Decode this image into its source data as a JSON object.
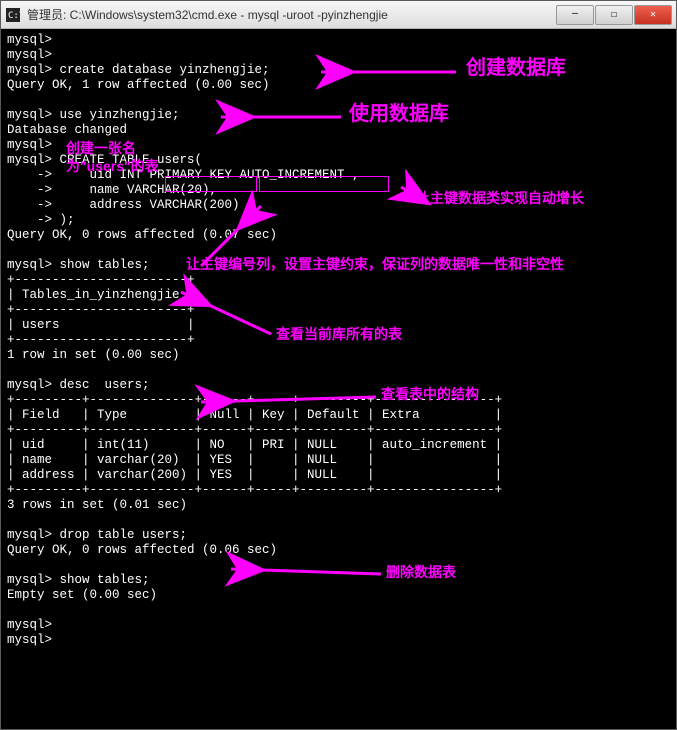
{
  "window": {
    "title": "管理员: C:\\Windows\\system32\\cmd.exe - mysql  -uroot -pyinzhengjie",
    "icon": "cmd-icon"
  },
  "controls": {
    "minimize": "—",
    "maximize": "☐",
    "close": "✕"
  },
  "terminal_lines": [
    "mysql>",
    "mysql>",
    "mysql> create database yinzhengjie;",
    "Query OK, 1 row affected (0.00 sec)",
    "",
    "mysql> use yinzhengjie;",
    "Database changed",
    "mysql>",
    "mysql> CREATE TABLE users(",
    "    ->     uid INT PRIMARY KEY AUTO_INCREMENT ,",
    "    ->     name VARCHAR(20),",
    "    ->     address VARCHAR(200)",
    "    -> );",
    "Query OK, 0 rows affected (0.07 sec)",
    "",
    "mysql> show tables;",
    "+-----------------------+",
    "| Tables_in_yinzhengjie |",
    "+-----------------------+",
    "| users                 |",
    "+-----------------------+",
    "1 row in set (0.00 sec)",
    "",
    "mysql> desc  users;",
    "+---------+--------------+------+-----+---------+----------------+",
    "| Field   | Type         | Null | Key | Default | Extra          |",
    "+---------+--------------+------+-----+---------+----------------+",
    "| uid     | int(11)      | NO   | PRI | NULL    | auto_increment |",
    "| name    | varchar(20)  | YES  |     | NULL    |                |",
    "| address | varchar(200) | YES  |     | NULL    |                |",
    "+---------+--------------+------+-----+---------+----------------+",
    "3 rows in set (0.01 sec)",
    "",
    "mysql> drop table users;",
    "Query OK, 0 rows affected (0.06 sec)",
    "",
    "mysql> show tables;",
    "Empty set (0.00 sec)",
    "",
    "mysql>",
    "mysql>"
  ],
  "annotations": {
    "create_db": "创建数据库",
    "use_db": "使用数据库",
    "create_table": "创建一张名\n为\"users\"的表",
    "auto_inc": "让主键数据类实现自动增长",
    "pk_note": "让主键编号列，设置主键约束，保证列的数据唯一性和非空性",
    "show_tables": "查看当前库所有的表",
    "desc_table": "查看表中的结构",
    "drop_table": "删除数据表"
  }
}
